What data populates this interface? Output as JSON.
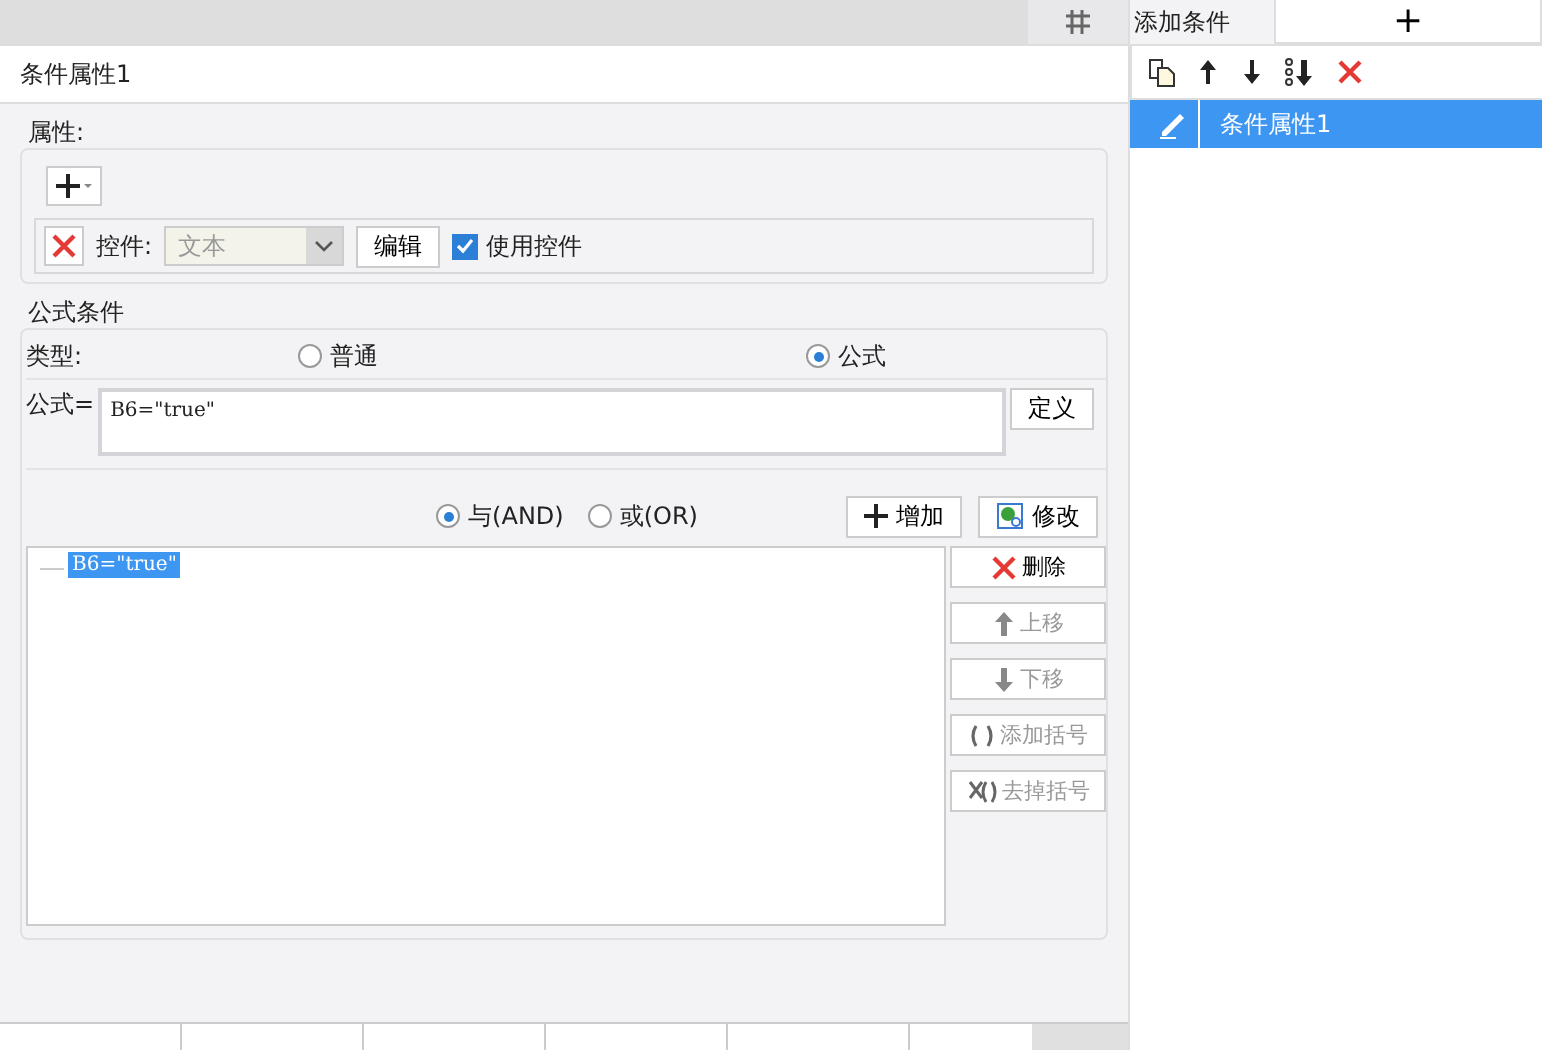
{
  "title": "条件属性1",
  "attributes": {
    "legend": "属性:",
    "control_label": "控件:",
    "control_value": "文本",
    "edit_button": "编辑",
    "use_control": {
      "label": "使用控件",
      "checked": true
    }
  },
  "formula_condition": {
    "legend": "公式条件",
    "type_label": "类型:",
    "types": [
      {
        "label": "普通",
        "selected": false
      },
      {
        "label": "公式",
        "selected": true
      }
    ],
    "formula_label": "公式=",
    "formula_value": "B6=\"true\"",
    "define_button": "定义",
    "logic": [
      {
        "label": "与(AND)",
        "selected": true
      },
      {
        "label": "或(OR)",
        "selected": false
      }
    ],
    "add_button": "增加",
    "modify_button": "修改",
    "conditions": [
      {
        "text": "B6=\"true\"",
        "selected": true
      }
    ],
    "side_buttons": [
      {
        "kind": "delete",
        "label": "删除",
        "disabled": false
      },
      {
        "kind": "up",
        "label": "上移",
        "disabled": true
      },
      {
        "kind": "down",
        "label": "下移",
        "disabled": true
      },
      {
        "kind": "paren",
        "label": "添加括号",
        "disabled": true
      },
      {
        "kind": "unparen",
        "label": "去掉括号",
        "disabled": true
      }
    ]
  },
  "right_panel": {
    "tab": "添加条件",
    "add_symbol": "+",
    "items": [
      {
        "label": "条件属性1",
        "selected": true
      }
    ]
  }
}
